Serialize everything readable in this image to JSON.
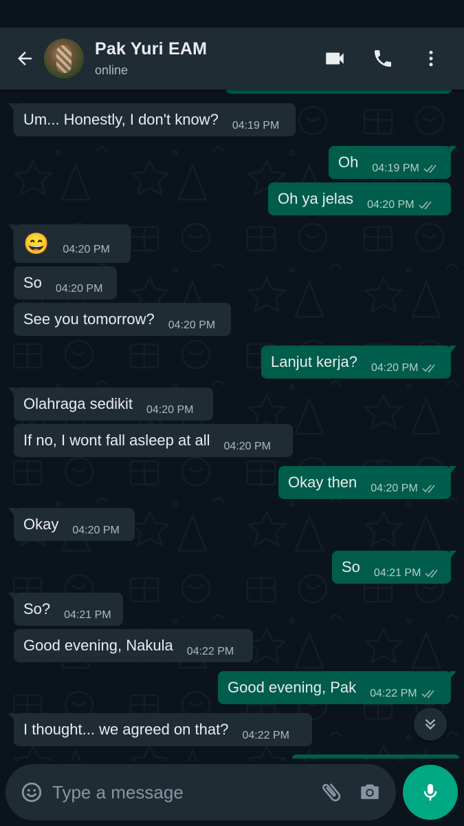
{
  "contact": {
    "name": "Pak Yuri EAM",
    "status": "online"
  },
  "messages": [
    {
      "direction": "in",
      "text": "Um... Honestly, I don't know?",
      "time": "04:19 PM"
    },
    {
      "direction": "out",
      "text": "Oh",
      "time": "04:19 PM",
      "read": true
    },
    {
      "direction": "out",
      "text": "Oh ya jelas",
      "time": "04:20 PM",
      "read": true
    },
    {
      "direction": "in",
      "text": "😄",
      "time": "04:20 PM"
    },
    {
      "direction": "in",
      "text": "So",
      "time": "04:20 PM"
    },
    {
      "direction": "in",
      "text": "See you tomorrow?",
      "time": "04:20 PM"
    },
    {
      "direction": "out",
      "text": "Lanjut kerja?",
      "time": "04:20 PM",
      "read": true
    },
    {
      "direction": "in",
      "text": "Olahraga sedikit",
      "time": "04:20 PM"
    },
    {
      "direction": "in",
      "text": "If no, I wont fall asleep at all",
      "time": "04:20 PM"
    },
    {
      "direction": "out",
      "text": "Okay then",
      "time": "04:20 PM",
      "read": true
    },
    {
      "direction": "in",
      "text": "Okay",
      "time": "04:20 PM"
    },
    {
      "direction": "out",
      "text": "So",
      "time": "04:21 PM",
      "read": true
    },
    {
      "direction": "in",
      "text": "So?",
      "time": "04:21 PM"
    },
    {
      "direction": "in",
      "text": "Good evening, Nakula",
      "time": "04:22 PM"
    },
    {
      "direction": "out",
      "text": "Good evening, Pak",
      "time": "04:22 PM",
      "read": true
    },
    {
      "direction": "in",
      "text": "I thought... we agreed on that?",
      "time": "04:22 PM"
    }
  ],
  "composer": {
    "placeholder": "Type a message"
  },
  "icons": {
    "back": "arrow-back-icon",
    "video": "video-call-icon",
    "call": "phone-icon",
    "menu": "more-vert-icon",
    "emoji": "emoji-icon",
    "attach": "paperclip-icon",
    "camera": "camera-icon",
    "mic": "mic-icon",
    "scroll": "chevron-double-down-icon"
  },
  "colors": {
    "header": "#1f2c34",
    "background": "#0b141a",
    "incoming": "#202c33",
    "outgoing": "#005c4b",
    "accent": "#00a884"
  }
}
